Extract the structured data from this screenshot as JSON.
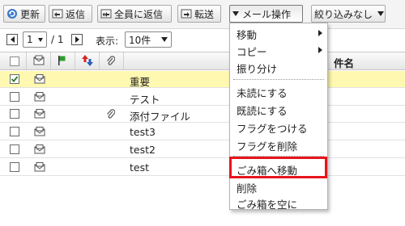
{
  "toolbar": {
    "refresh": "更新",
    "reply": "返信",
    "reply_all": "全員に返信",
    "forward": "転送",
    "mail_ops": "メール操作",
    "filter": "絞り込みなし"
  },
  "pager": {
    "page": "1",
    "total": "/ 1",
    "display_label": "表示:",
    "per_page": "10件"
  },
  "table": {
    "subject_header": "件名",
    "rows": [
      {
        "checked": true,
        "attachment": false,
        "subject": "重要"
      },
      {
        "checked": false,
        "attachment": false,
        "subject": "テスト"
      },
      {
        "checked": false,
        "attachment": true,
        "subject": "添付ファイル"
      },
      {
        "checked": false,
        "attachment": false,
        "subject": "test3"
      },
      {
        "checked": false,
        "attachment": false,
        "subject": "test2"
      },
      {
        "checked": false,
        "attachment": false,
        "subject": "test"
      }
    ]
  },
  "menu": {
    "items": [
      {
        "label": "移動",
        "submenu": true
      },
      {
        "label": "コピー",
        "submenu": true
      },
      {
        "label": "振り分け",
        "submenu": false
      },
      {
        "label": "未読にする",
        "submenu": false
      },
      {
        "label": "既読にする",
        "submenu": false
      },
      {
        "label": "フラグをつける",
        "submenu": false
      },
      {
        "label": "フラグを削除",
        "submenu": false
      },
      {
        "label": "ごみ箱へ移動",
        "submenu": false
      },
      {
        "label": "削除",
        "submenu": false
      },
      {
        "label": "ごみ箱を空に",
        "submenu": false
      }
    ],
    "highlighted": "ごみ箱へ移動"
  },
  "colors": {
    "highlight_row": "#fff8b0",
    "callout_border": "#e8141c",
    "flag_green": "#2e9e2e"
  }
}
